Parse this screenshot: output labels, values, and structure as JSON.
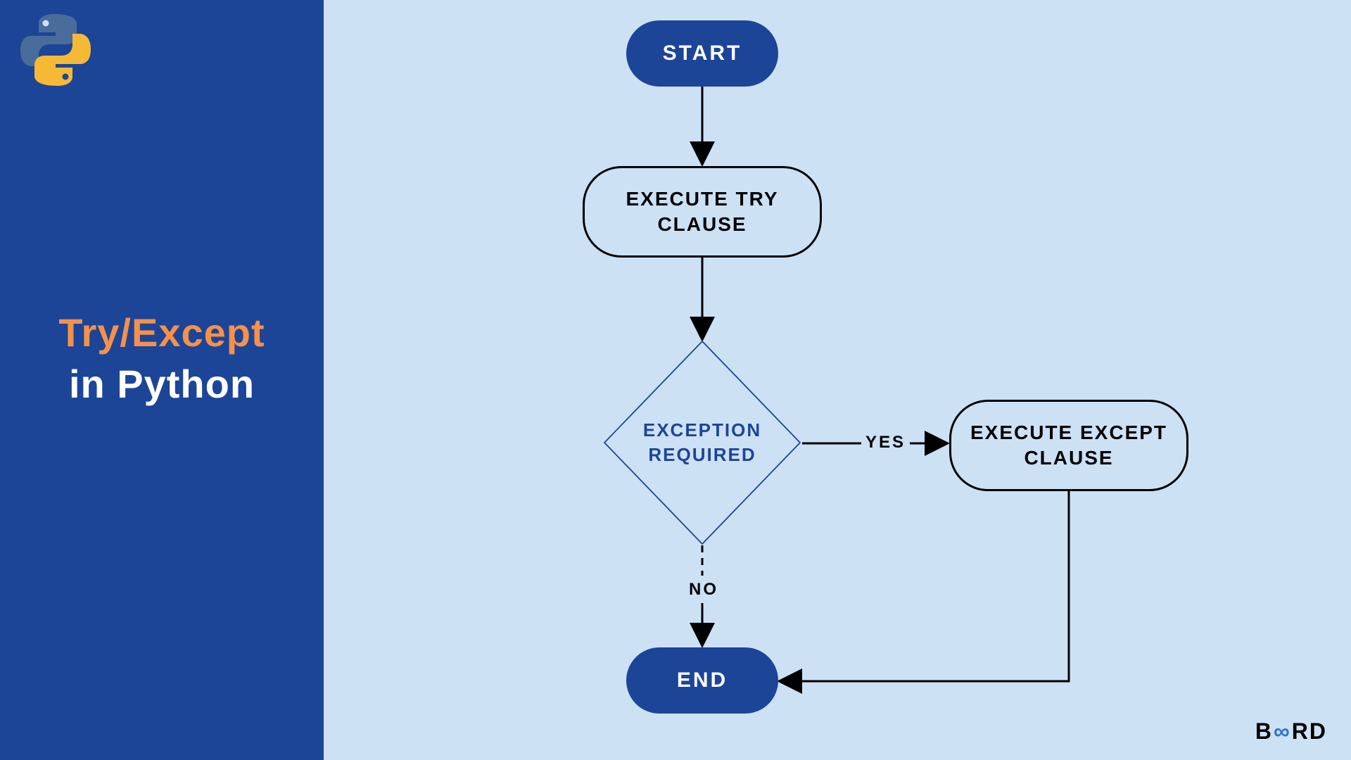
{
  "sidebar": {
    "title_line1": "Try/Except",
    "title_line2": "in Python"
  },
  "flowchart": {
    "start": "START",
    "try": "EXECUTE TRY CLAUSE",
    "decision": "EXCEPTION REQUIRED",
    "except": "EXECUTE EXCEPT CLAUSE",
    "end": "END",
    "yes": "YES",
    "no": "NO"
  },
  "branding": {
    "logo_prefix": "B",
    "logo_infinity": "∞",
    "logo_suffix": "RD"
  },
  "colors": {
    "sidebar_bg": "#1c4598",
    "canvas_bg": "#cde1f5",
    "accent_orange": "#f5914a",
    "node_fill": "#1c4598",
    "node_text": "#ffffff",
    "outline": "#000000",
    "decision_text": "#1c4598"
  }
}
